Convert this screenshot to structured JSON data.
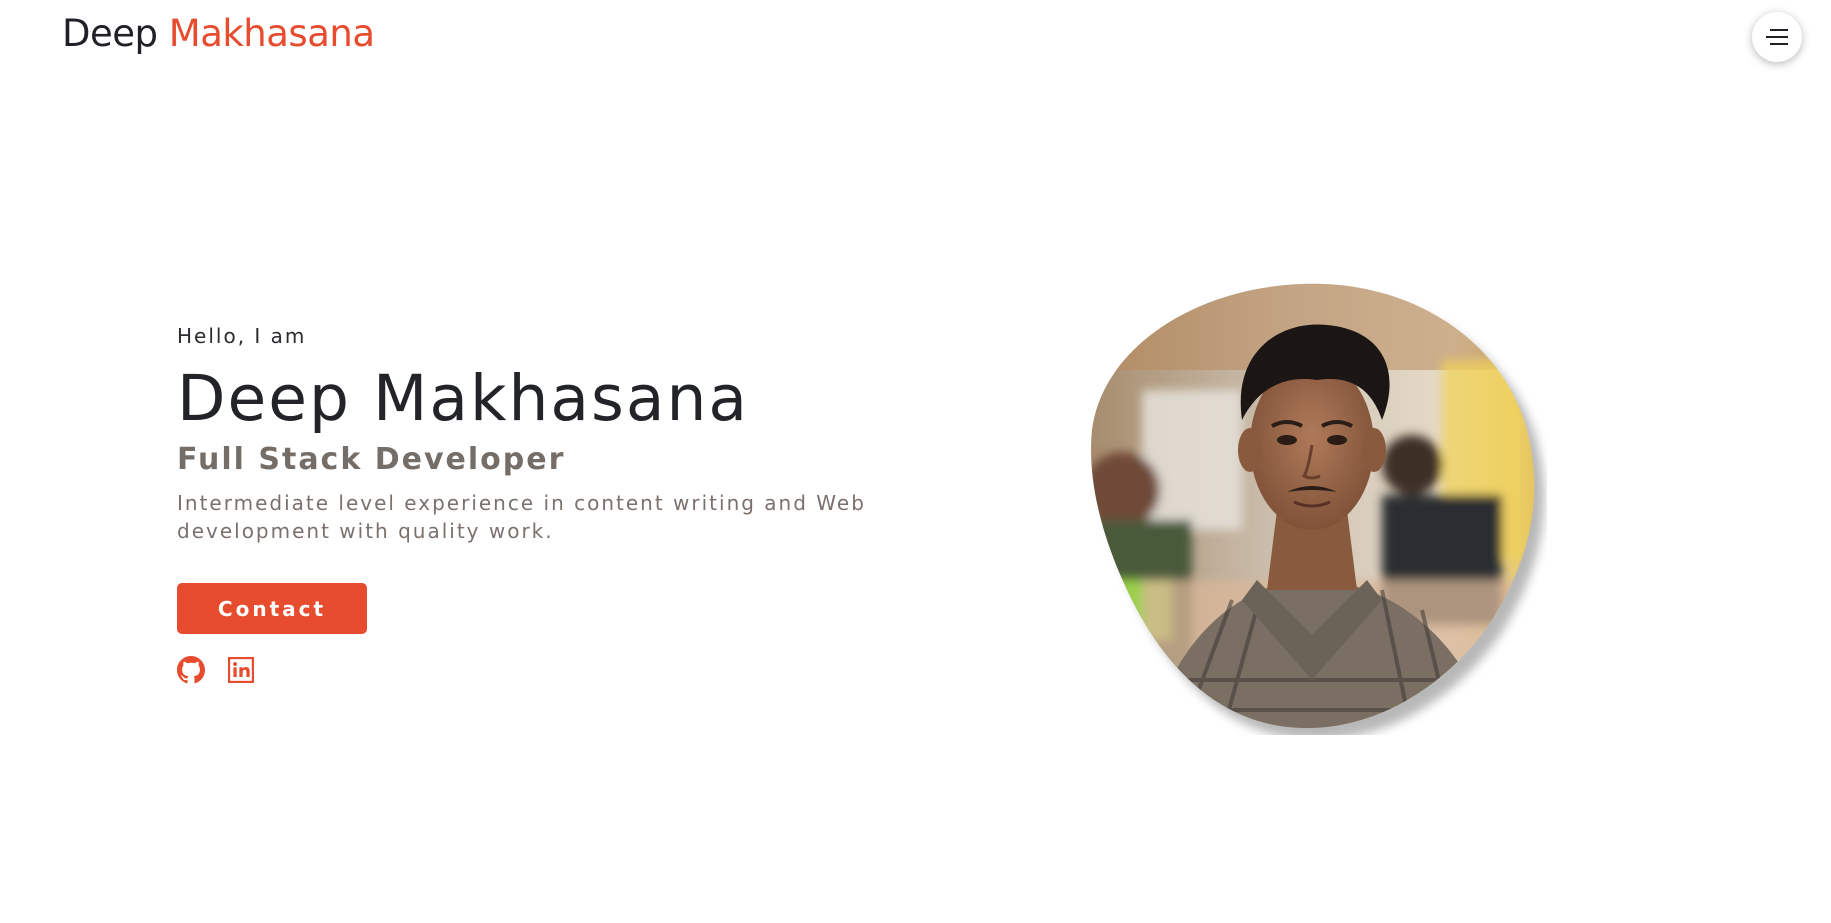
{
  "header": {
    "logo_first": "Deep",
    "logo_last": "Makhasana",
    "menu_icon": "hamburger-menu-icon"
  },
  "hero": {
    "greeting": "Hello, I am",
    "name": "Deep Makhasana",
    "role": "Full Stack Developer",
    "description": "Intermediate level experience in content writing and Web development with quality work.",
    "contact_label": "Contact",
    "socials": [
      {
        "icon": "github-icon"
      },
      {
        "icon": "linkedin-icon"
      }
    ],
    "portrait_icon": "profile-photo"
  },
  "colors": {
    "accent": "#e64c2d",
    "heading": "#222428",
    "subtle": "#756d68",
    "background": "#ffffff"
  }
}
